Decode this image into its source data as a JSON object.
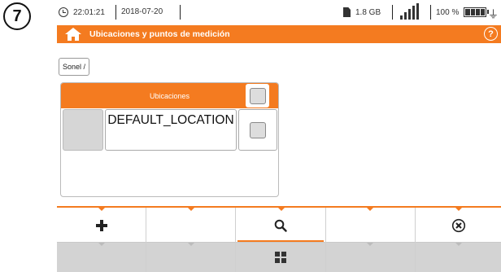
{
  "step": {
    "number": "7"
  },
  "status_bar": {
    "time": "22:01:21",
    "date": "2018-07-20",
    "storage": "1.8 GB",
    "battery": "100 %",
    "icons": [
      "clock-icon",
      "sd-card-icon",
      "signal-icon",
      "battery-icon",
      "plug-icon"
    ]
  },
  "title_bar": {
    "title": "Ubicaciones y puntos de medición",
    "help_label": "?",
    "icons": [
      "home-icon",
      "help-icon"
    ]
  },
  "breadcrumb": {
    "path": "Sonel /"
  },
  "table": {
    "header": "Ubicaciones",
    "rows": [
      {
        "name": "DEFAULT_LOCATION"
      }
    ]
  },
  "toolbar": {
    "row1": [
      "plus-icon",
      "",
      "search-icon",
      "",
      "cancel-icon"
    ],
    "row2": [
      "",
      "",
      "grid-icon",
      "",
      ""
    ]
  },
  "colors": {
    "accent": "#f47b20",
    "toolbar_bottom": "#d3d3d3",
    "cell_gray": "#d6d6d6"
  }
}
